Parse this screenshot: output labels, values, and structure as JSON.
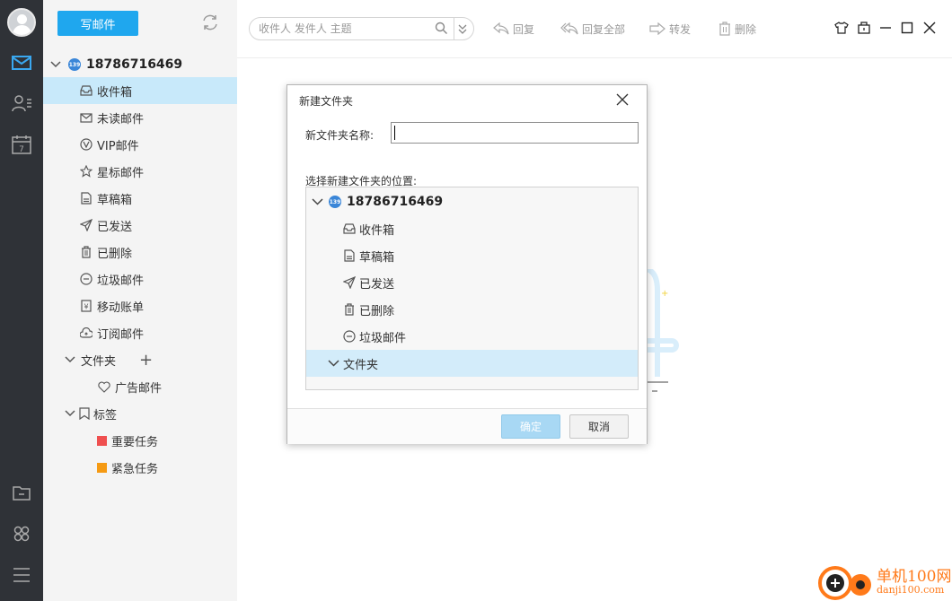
{
  "colors": {
    "rail_bg": "#2f3237",
    "panel_bg": "#f4f4f4",
    "accent": "#1fa7ee",
    "selected_row": "#c8e9fa",
    "tag_important": "#ef4f4f",
    "tag_urgent": "#f59a13",
    "watermark": "#ff7a1a"
  },
  "rail": {
    "icons": [
      "avatar",
      "mail-icon",
      "contacts-icon",
      "calendar-icon",
      "folder-icon",
      "apps-icon",
      "menu-icon"
    ],
    "calendar_day": "7"
  },
  "folders": {
    "compose_label": "写邮件",
    "account": "18786716469",
    "account_badge": "139",
    "items": [
      {
        "label": "收件箱",
        "icon": "inbox-icon",
        "active": true
      },
      {
        "label": "未读邮件",
        "icon": "envelope-icon"
      },
      {
        "label": "VIP邮件",
        "icon": "vip-icon"
      },
      {
        "label": "星标邮件",
        "icon": "star-icon"
      },
      {
        "label": "草稿箱",
        "icon": "draft-icon"
      },
      {
        "label": "已发送",
        "icon": "send-icon"
      },
      {
        "label": "已删除",
        "icon": "trash-icon"
      },
      {
        "label": "垃圾邮件",
        "icon": "spam-icon"
      },
      {
        "label": "移动账单",
        "icon": "bill-icon"
      },
      {
        "label": "订阅邮件",
        "icon": "subscribe-icon"
      }
    ],
    "folder_group_label": "文件夹",
    "folder_add": "+",
    "custom_folders": [
      {
        "label": "广告邮件",
        "icon": "tag-heart-icon"
      }
    ],
    "tags_group_label": "标签",
    "tags": [
      {
        "label": "重要任务",
        "color": "#ef4f4f"
      },
      {
        "label": "紧急任务",
        "color": "#f59a13"
      }
    ]
  },
  "toolbar": {
    "search_placeholder": "收件人 发件人 主题",
    "reply": "回复",
    "reply_all": "回复全部",
    "forward": "转发",
    "delete": "删除"
  },
  "dialog": {
    "title": "新建文件夹",
    "name_label": "新文件夹名称:",
    "name_value": "",
    "location_label": "选择新建文件夹的位置:",
    "tree_root": "18786716469",
    "tree_badge": "139",
    "tree_items": [
      {
        "label": "收件箱",
        "icon": "inbox-icon"
      },
      {
        "label": "草稿箱",
        "icon": "draft-icon"
      },
      {
        "label": "已发送",
        "icon": "send-icon"
      },
      {
        "label": "已删除",
        "icon": "trash-icon"
      },
      {
        "label": "垃圾邮件",
        "icon": "spam-icon"
      }
    ],
    "tree_folder": "文件夹",
    "ok_label": "确定",
    "cancel_label": "取消"
  },
  "watermark": {
    "line1": "单机100网",
    "line2": "danji100.com"
  }
}
